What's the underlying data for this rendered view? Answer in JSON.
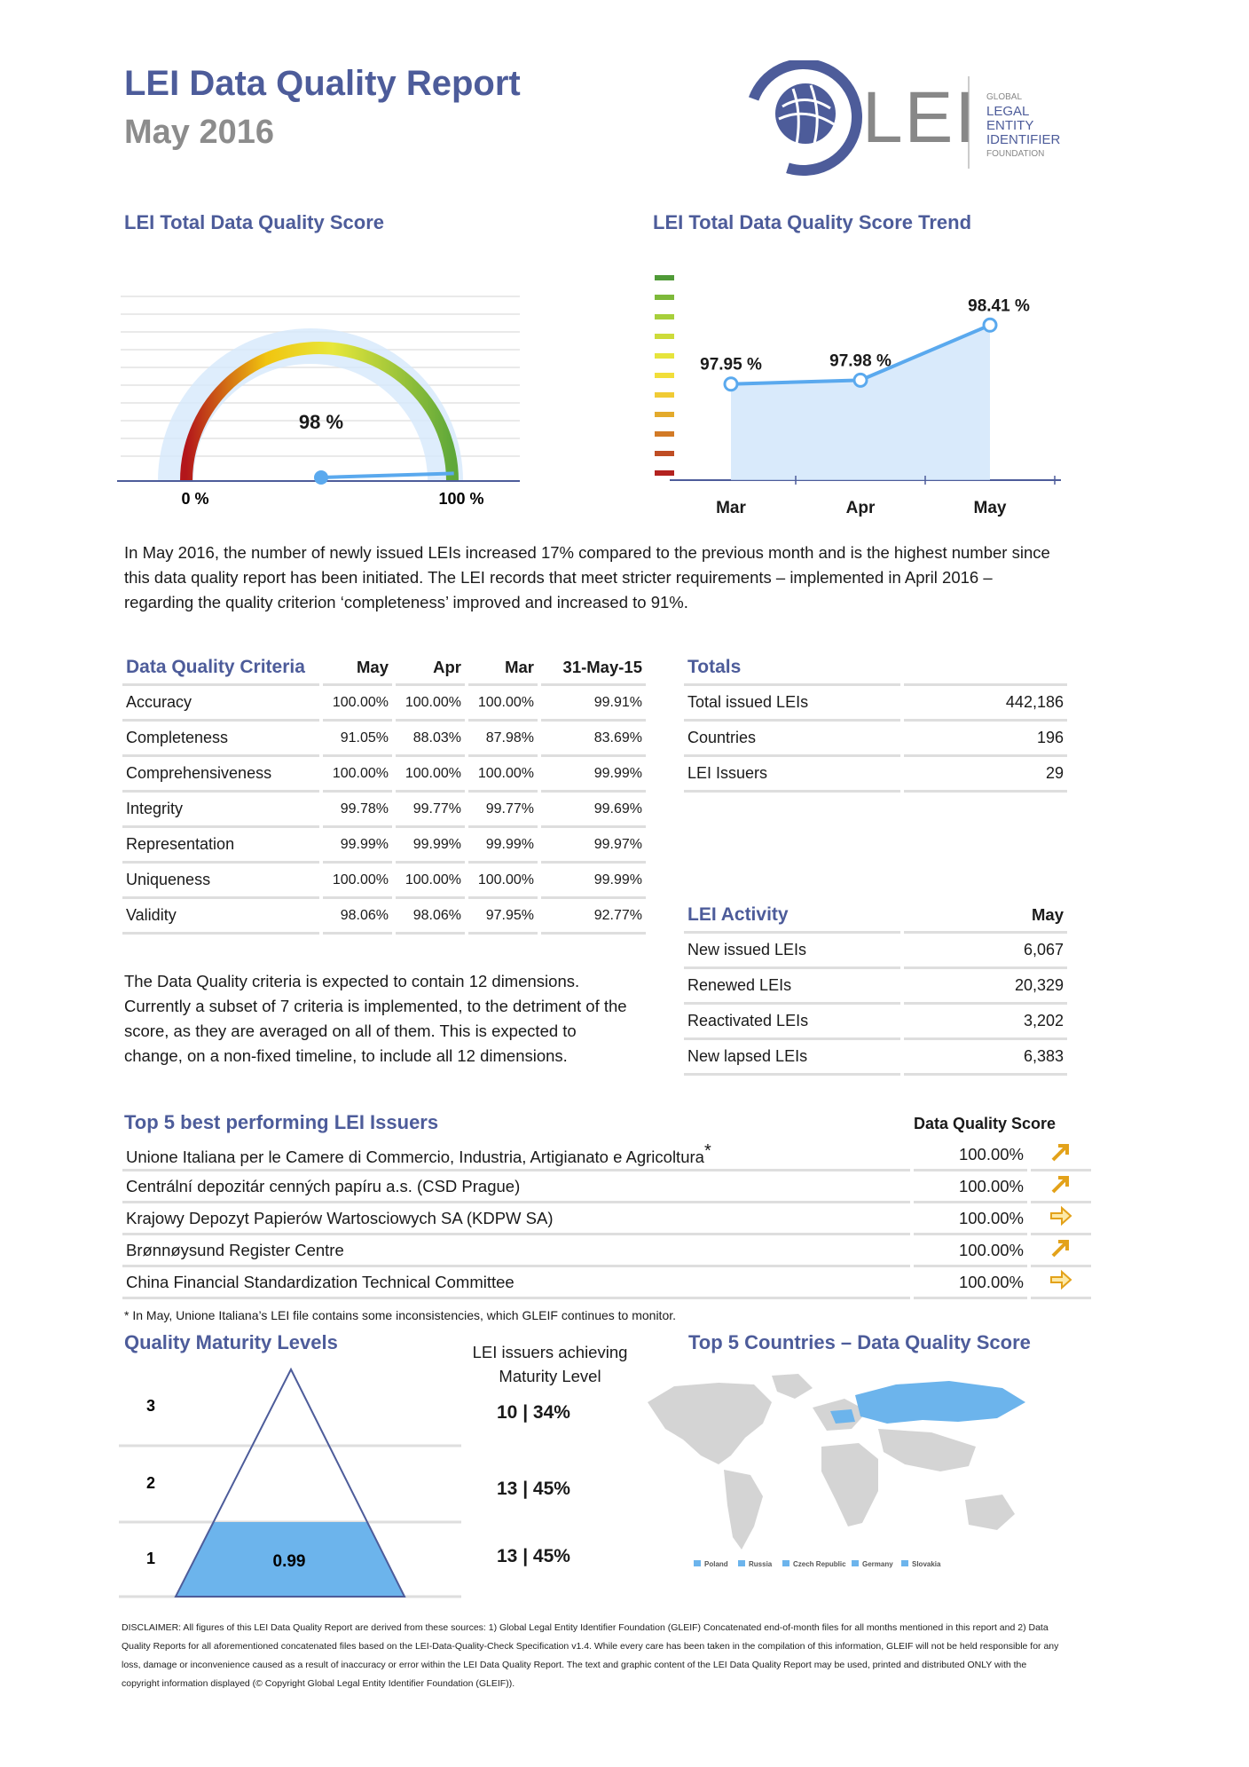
{
  "header": {
    "title": "LEI Data Quality Report",
    "subtitle": "May 2016",
    "logo": {
      "mark": "LEI",
      "lines": [
        "GLOBAL",
        "LEGAL",
        "ENTITY",
        "IDENTIFIER",
        "FOUNDATION"
      ]
    }
  },
  "score": {
    "title": "LEI Total Data Quality Score",
    "value_label": "98 %",
    "min_label": "0 %",
    "max_label": "100 %",
    "value": 0.98
  },
  "trend": {
    "title": "LEI Total Data Quality Score Trend"
  },
  "chart_data": {
    "type": "line",
    "categories": [
      "Mar",
      "Apr",
      "May"
    ],
    "values": [
      97.95,
      97.98,
      98.41
    ],
    "data_labels": [
      "97.95 %",
      "97.98 %",
      "98.41 %"
    ],
    "ylim": [
      97.2,
      98.8
    ],
    "grid": false
  },
  "intro": "In May 2016, the number of newly issued LEIs increased 17% compared to the previous month and is the highest number since this data quality report has been initiated. The LEI records that meet stricter requirements – implemented in April 2016 – regarding the quality criterion ‘completeness’ improved and increased to 91%.",
  "criteria": {
    "headers": [
      "Data Quality Criteria",
      "May",
      "Apr",
      "Mar",
      "31-May-15"
    ],
    "rows": [
      [
        "Accuracy",
        "100.00%",
        "100.00%",
        "100.00%",
        "99.91%"
      ],
      [
        "Completeness",
        "91.05%",
        "88.03%",
        "87.98%",
        "83.69%"
      ],
      [
        "Comprehensiveness",
        "100.00%",
        "100.00%",
        "100.00%",
        "99.99%"
      ],
      [
        "Integrity",
        "99.78%",
        "99.77%",
        "99.77%",
        "99.69%"
      ],
      [
        "Representation",
        "99.99%",
        "99.99%",
        "99.99%",
        "99.97%"
      ],
      [
        "Uniqueness",
        "100.00%",
        "100.00%",
        "100.00%",
        "99.99%"
      ],
      [
        "Validity",
        "98.06%",
        "98.06%",
        "97.95%",
        "92.77%"
      ]
    ]
  },
  "totals": {
    "title": "Totals",
    "rows": [
      [
        "Total issued LEIs",
        "442,186"
      ],
      [
        "Countries",
        "196"
      ],
      [
        "LEI Issuers",
        "29"
      ]
    ]
  },
  "criteria_note": "The Data Quality criteria is expected to contain 12 dimensions. Currently a subset of 7 criteria is implemented, to the detriment of the score, as they are averaged on all of them. This is expected to change, on a non-fixed timeline, to include all 12 dimensions.",
  "activity": {
    "title": "LEI Activity",
    "column": "May",
    "rows": [
      [
        "New issued LEIs",
        "6,067"
      ],
      [
        "Renewed LEIs",
        "20,329"
      ],
      [
        "Reactivated LEIs",
        "3,202"
      ],
      [
        "New lapsed LEIs",
        "6,383"
      ]
    ]
  },
  "top_issuers": {
    "title": "Top 5 best performing LEI Issuers",
    "column": "Data Quality Score",
    "rows": [
      {
        "name": "Unione Italiana per le Camere di Commercio, Industria, Artigianato e Agricoltura",
        "mark": "*",
        "score": "100.00%",
        "trend": "up-right-arrow"
      },
      {
        "name": "Centrální depozitár cenných papíru a.s. (CSD Prague)",
        "mark": "",
        "score": "100.00%",
        "trend": "up-right-arrow"
      },
      {
        "name": "Krajowy Depozyt Papierów Wartosciowych SA (KDPW SA)",
        "mark": "",
        "score": "100.00%",
        "trend": "right-arrow"
      },
      {
        "name": "Brønnøysund Register Centre",
        "mark": "",
        "score": "100.00%",
        "trend": "up-right-arrow"
      },
      {
        "name": "China Financial Standardization Technical Committee",
        "mark": "",
        "score": "100.00%",
        "trend": "right-arrow"
      }
    ],
    "footnote": "* In May, Unione Italiana’s LEI file contains some inconsistencies, which GLEIF continues to monitor."
  },
  "maturity": {
    "title": "Quality Maturity Levels",
    "caption": "LEI issuers achieving Maturity Level",
    "levels": [
      {
        "level": "3",
        "value": "10 | 34%"
      },
      {
        "level": "2",
        "value": "13 | 45%"
      },
      {
        "level": "1",
        "value": "13 | 45%"
      }
    ],
    "fill_label": "0.99",
    "fill_color": "#6cb4ec"
  },
  "countries": {
    "title": "Top 5 Countries – Data Quality Score",
    "legend": [
      "Poland",
      "Russia",
      "Czech Republic",
      "Germany",
      "Slovakia"
    ],
    "highlight_color": "#6cb4ec"
  },
  "disclaimer": "DISCLAIMER: All figures of this LEI Data Quality Report are derived from these sources: 1) Global Legal Entity Identifier Foundation (GLEIF) Concatenated end-of-month files for all months mentioned in this report and 2) Data Quality Reports for all aforementioned concatenated files based on the LEI-Data-Quality-Check Specification v1.4. While every care has been taken in the compilation of this information, GLEIF will not be held responsible for any loss, damage or inconvenience caused as a result of inaccuracy or error within the LEI Data Quality Report. The text and graphic content of the LEI Data Quality Report may be used, printed and distributed ONLY with the copyright information displayed (© Copyright Global Legal Entity Identifier Foundation (GLEIF))."
}
